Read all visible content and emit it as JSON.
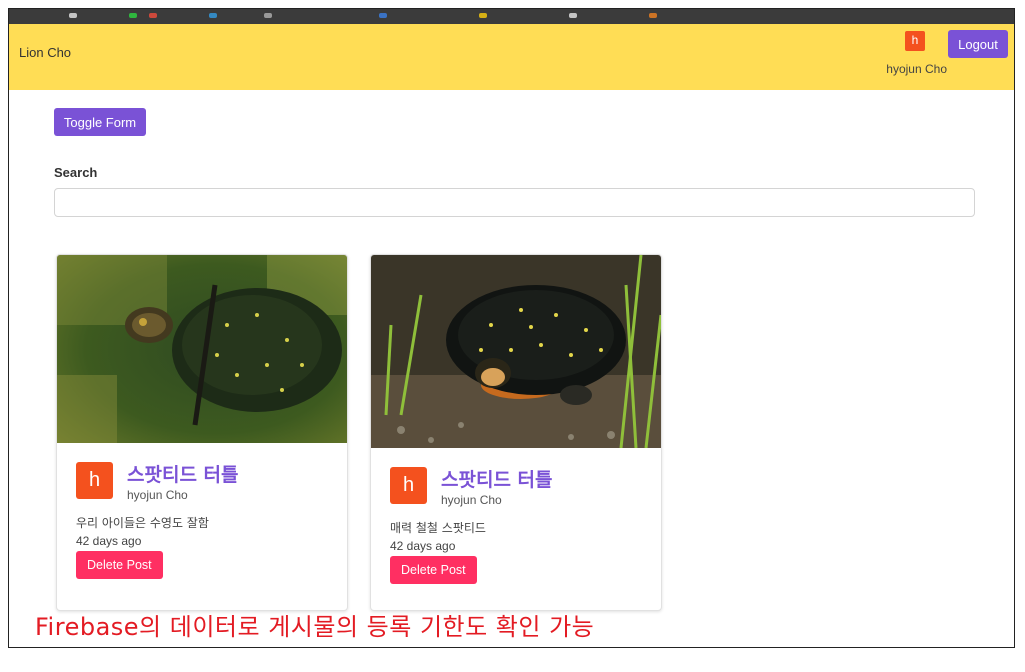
{
  "navbar": {
    "brand": "Lion Cho",
    "avatar_letter": "h",
    "user_name": "hyojun Cho",
    "logout_label": "Logout",
    "bg_color": "#ffdd55"
  },
  "toolbar": {
    "toggle_form_label": "Toggle Form"
  },
  "search": {
    "label": "Search",
    "value": "",
    "placeholder": ""
  },
  "posts": [
    {
      "avatar_letter": "h",
      "title": "스팟티드 터틀",
      "author": "hyojun Cho",
      "content": "우리 아이들은 수영도 잘함",
      "date": "42 days ago",
      "delete_label": "Delete Post",
      "image": "turtle-swimming"
    },
    {
      "avatar_letter": "h",
      "title": "스팟티드 터틀",
      "author": "hyojun Cho",
      "content": "매력 철철 스팟티드",
      "date": "42 days ago",
      "delete_label": "Delete Post",
      "image": "turtle-on-ground"
    }
  ],
  "annotation": "Firebase의 데이터로 게시물의 등록 기한도 확인 가능",
  "colors": {
    "accent": "#7a52d6",
    "danger": "#ff2f62",
    "avatar": "#f4511e",
    "annotation": "#e31b23"
  }
}
